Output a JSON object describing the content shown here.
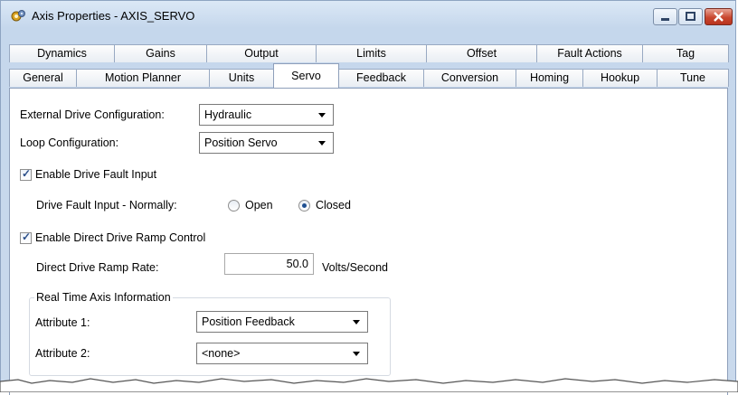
{
  "window": {
    "title": "Axis Properties - AXIS_SERVO"
  },
  "tabs": {
    "row1": [
      "Dynamics",
      "Gains",
      "Output",
      "Limits",
      "Offset",
      "Fault Actions",
      "Tag"
    ],
    "row2": [
      "General",
      "Motion Planner",
      "Units",
      "Servo",
      "Feedback",
      "Conversion",
      "Homing",
      "Hookup",
      "Tune"
    ],
    "active": "Servo"
  },
  "servo": {
    "ext_drive_label": "External Drive Configuration:",
    "ext_drive_value": "Hydraulic",
    "loop_label": "Loop Configuration:",
    "loop_value": "Position Servo",
    "enable_fault_label": "Enable Drive Fault Input",
    "enable_fault_checked": true,
    "fault_normally_label": "Drive Fault Input - Normally:",
    "radio_open_label": "Open",
    "radio_closed_label": "Closed",
    "radio_selected": "Closed",
    "enable_ramp_label": "Enable Direct Drive Ramp Control",
    "enable_ramp_checked": true,
    "ramp_rate_label": "Direct Drive Ramp Rate:",
    "ramp_rate_value": "50.0",
    "ramp_rate_unit": "Volts/Second"
  },
  "realtime": {
    "group_title": "Real Time Axis Information",
    "attr1_label": "Attribute 1:",
    "attr1_value": "Position Feedback",
    "attr2_label": "Attribute 2:",
    "attr2_value": "<none>"
  },
  "colors": {
    "title_close": "#c9472f",
    "radio_dot": "#1f4f91",
    "check": "#2b4f8a"
  },
  "icons": [
    "app-gear-icon",
    "minimize-icon",
    "maximize-icon",
    "close-icon",
    "checkmark-icon",
    "dropdown-arrow-icon"
  ]
}
